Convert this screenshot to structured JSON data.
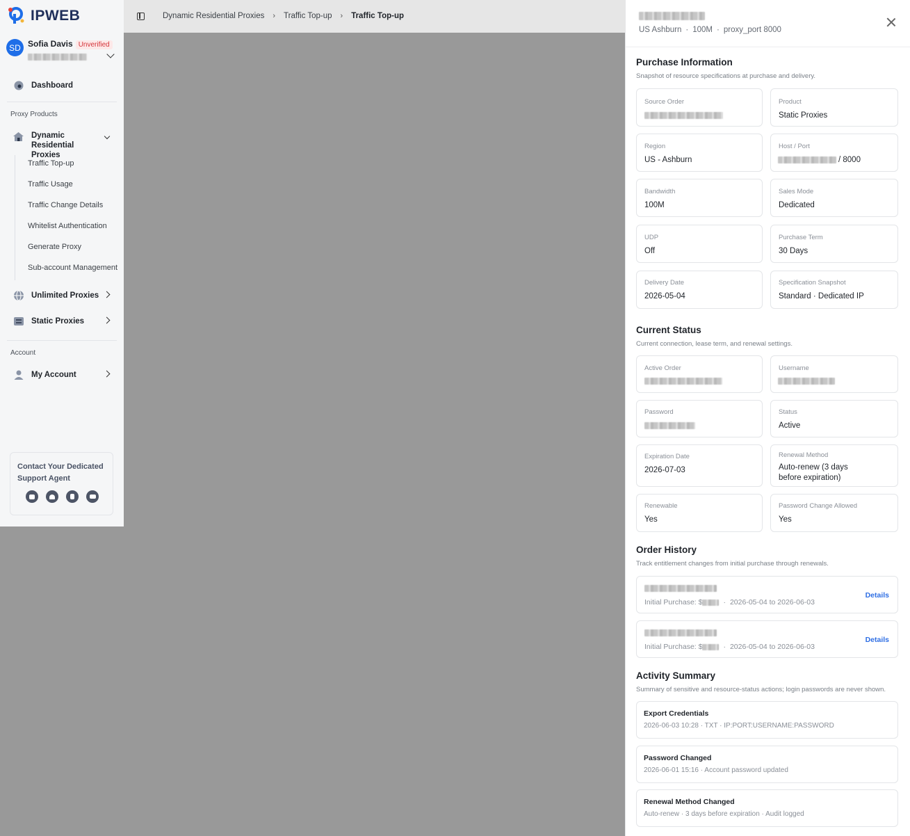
{
  "brand": {
    "name": "IPWEB",
    "color": "#1e6ee8"
  },
  "user": {
    "initials": "SD",
    "name": "Sofia Davis",
    "badge": "Unverified"
  },
  "sidebar": {
    "dashboard": "Dashboard",
    "section_products": "Proxy Products",
    "dynamic_residential": "Dynamic Residential Proxies",
    "sub_items": [
      "Traffic Top-up",
      "Traffic Usage",
      "Traffic Change Details",
      "Whitelist Authentication",
      "Generate Proxy",
      "Sub-account Management"
    ],
    "unlimited": "Unlimited Proxies",
    "static": "Static Proxies",
    "section_account": "Account",
    "my_account": "My Account",
    "support_title": "Contact Your Dedicated Support Agent",
    "support_icons": [
      "chat-icon",
      "bell-icon",
      "book-icon",
      "mail-icon"
    ]
  },
  "breadcrumb": [
    "Dynamic Residential Proxies",
    "Traffic Top-up",
    "Traffic Top-up"
  ],
  "drawer": {
    "meta": [
      "US Ashburn",
      "100M",
      "proxy_port 8000"
    ],
    "purchase": {
      "title": "Purchase Information",
      "subtitle": "Snapshot of resource specifications at purchase and delivery.",
      "fields": [
        {
          "label": "Source Order",
          "value": ""
        },
        {
          "label": "Product",
          "value": "Static Proxies"
        },
        {
          "label": "Region",
          "value": "US - Ashburn"
        },
        {
          "label": "Host / Port",
          "value": "/ 8000"
        },
        {
          "label": "Bandwidth",
          "value": "100M"
        },
        {
          "label": "Sales Mode",
          "value": "Dedicated"
        },
        {
          "label": "UDP",
          "value": "Off"
        },
        {
          "label": "Purchase Term",
          "value": "30 Days"
        },
        {
          "label": "Delivery Date",
          "value": "2026-05-04"
        },
        {
          "label": "Specification Snapshot",
          "value": "Standard · Dedicated IP"
        }
      ]
    },
    "status": {
      "title": "Current Status",
      "subtitle": "Current connection, lease term, and renewal settings.",
      "fields": [
        {
          "label": "Active Order",
          "value": ""
        },
        {
          "label": "Username",
          "value": ""
        },
        {
          "label": "Password",
          "value": ""
        },
        {
          "label": "Status",
          "value": "Active"
        },
        {
          "label": "Expiration Date",
          "value": "2026-07-03"
        },
        {
          "label": "Renewal Method",
          "value": "Auto-renew (3 days before expiration)"
        },
        {
          "label": "Renewable",
          "value": "Yes"
        },
        {
          "label": "Password Change Allowed",
          "value": "Yes"
        }
      ]
    },
    "history": {
      "title": "Order History",
      "subtitle": "Track entitlement changes from initial purchase through renewals.",
      "items": [
        {
          "prefix": "Initial Purchase: $",
          "period": "2026-05-04 to 2026-06-03",
          "link": "Details"
        },
        {
          "prefix": "Initial Purchase: $",
          "period": "2026-05-04 to 2026-06-03",
          "link": "Details"
        }
      ]
    },
    "activity": {
      "title": "Activity Summary",
      "subtitle": "Summary of sensitive and resource-status actions; login passwords are never shown.",
      "items": [
        {
          "title": "Export Credentials",
          "line": "2026-06-03 10:28  ·  TXT  ·  IP:PORT:USERNAME:PASSWORD"
        },
        {
          "title": "Password Changed",
          "line": "2026-06-01 15:16  ·  Account password updated"
        },
        {
          "title": "Renewal Method Changed",
          "line": "Auto-renew  ·  3 days before expiration  ·  Audit logged"
        }
      ]
    }
  }
}
